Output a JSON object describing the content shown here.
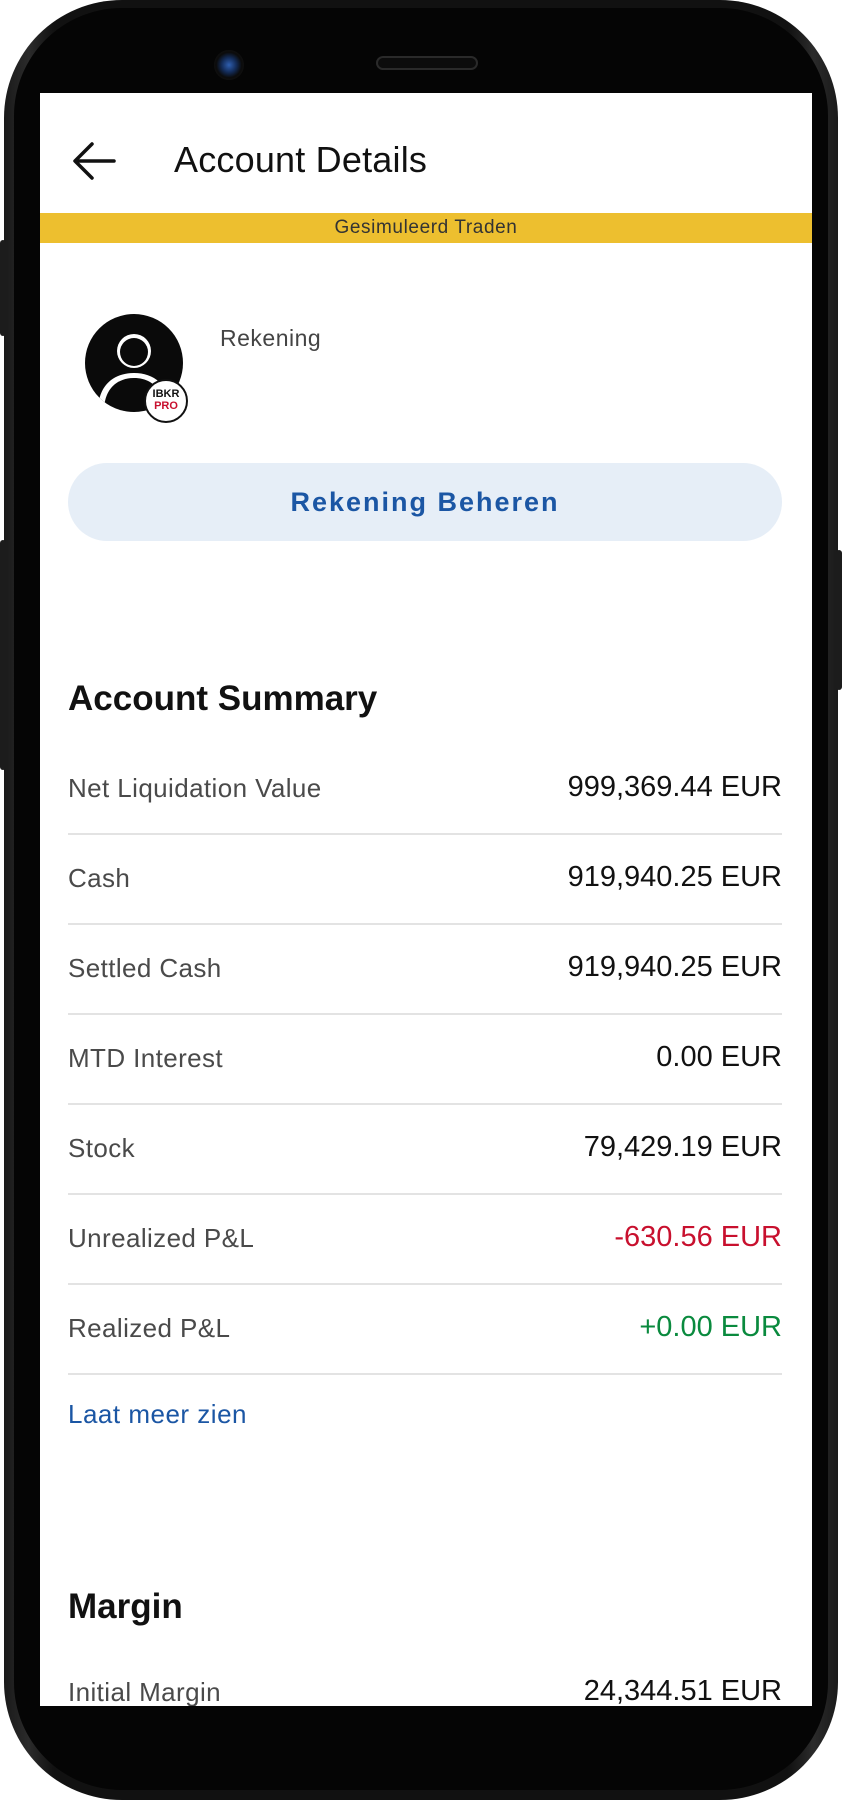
{
  "header": {
    "title": "Account Details"
  },
  "banner": {
    "text": "Gesimuleerd Traden"
  },
  "profile": {
    "account_label": "Rekening",
    "badge_top": "IBKR",
    "badge_bottom": "PRO",
    "manage_button": "Rekening Beheren"
  },
  "summary": {
    "title": "Account Summary",
    "rows": [
      {
        "label": "Net Liquidation Value",
        "value": "999,369.44 EUR"
      },
      {
        "label": "Cash",
        "value": "919,940.25 EUR"
      },
      {
        "label": "Settled Cash",
        "value": "919,940.25 EUR"
      },
      {
        "label": "MTD Interest",
        "value": "0.00 EUR"
      },
      {
        "label": "Stock",
        "value": "79,429.19 EUR"
      },
      {
        "label": "Unrealized P&L",
        "value": "-630.56 EUR"
      },
      {
        "label": "Realized P&L",
        "value": "+0.00 EUR"
      }
    ],
    "show_more": "Laat meer zien"
  },
  "margin": {
    "title": "Margin",
    "rows": [
      {
        "label": "Initial Margin",
        "value": "24,344.51 EUR"
      }
    ]
  },
  "colors": {
    "banner": "#edbf2f",
    "accent": "#1b56a4",
    "negative": "#c8102e",
    "positive": "#0a8a3e"
  }
}
